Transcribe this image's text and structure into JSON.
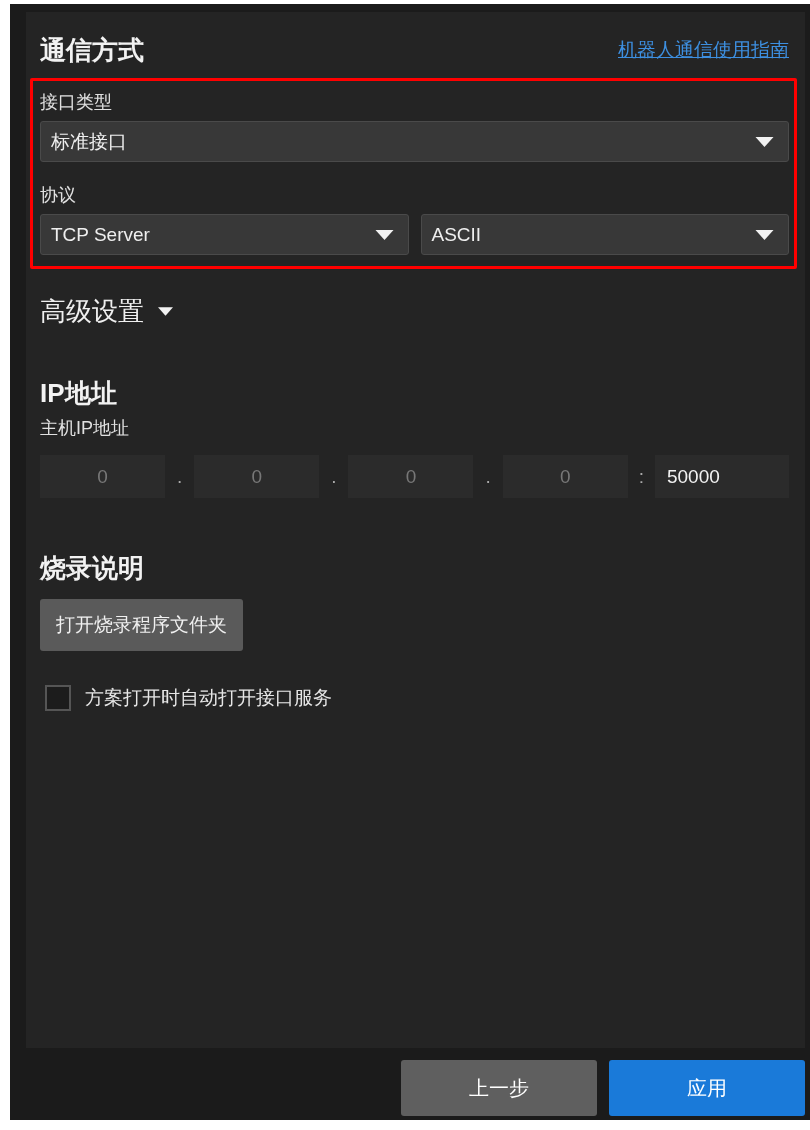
{
  "header": {
    "title": "通信方式",
    "link": "机器人通信使用指南"
  },
  "interface": {
    "label": "接口类型",
    "value": "标准接口"
  },
  "protocol": {
    "label": "协议",
    "values": [
      "TCP Server",
      "ASCII"
    ]
  },
  "advanced": {
    "title": "高级设置"
  },
  "ip": {
    "title": "IP地址",
    "label": "主机IP地址",
    "fields": [
      {
        "placeholder": "0"
      },
      {
        "placeholder": "0"
      },
      {
        "placeholder": "0"
      },
      {
        "placeholder": "0"
      },
      {
        "value": "50000"
      }
    ],
    "separators": [
      ".",
      ".",
      ".",
      ":"
    ]
  },
  "burn": {
    "title": "烧录说明",
    "button": "打开烧录程序文件夹"
  },
  "auto_start": {
    "label": "方案打开时自动打开接口服务",
    "checked": false
  },
  "buttons": [
    {
      "label": "上一步",
      "kind": "secondary"
    },
    {
      "label": "应用",
      "kind": "primary"
    }
  ]
}
